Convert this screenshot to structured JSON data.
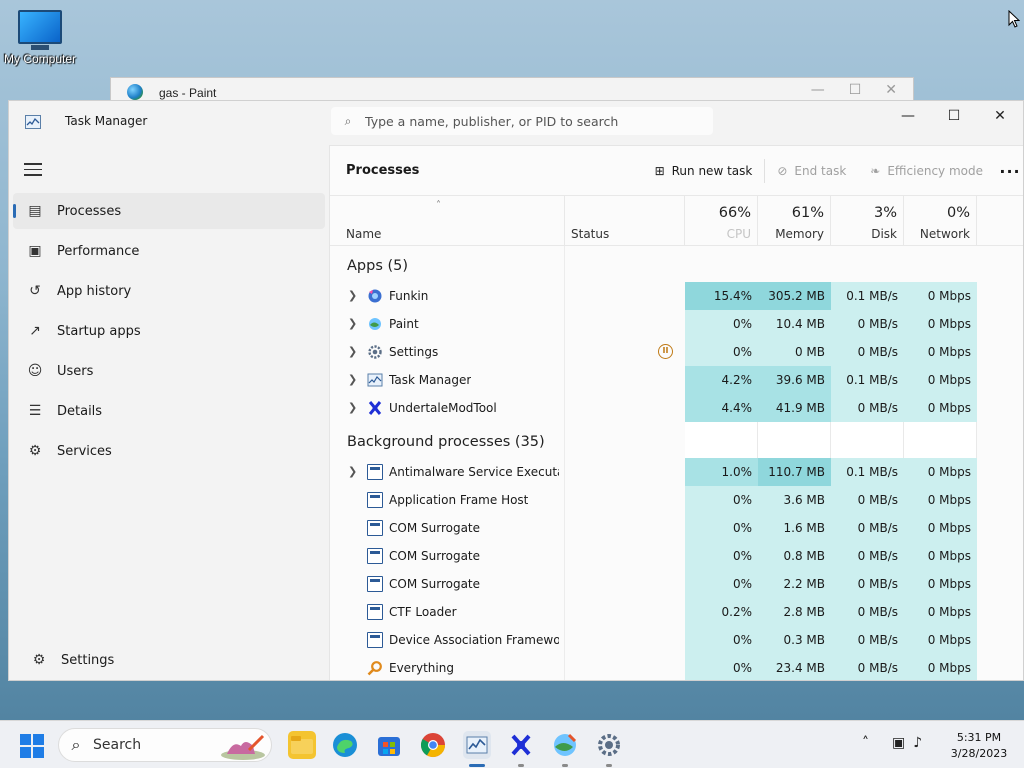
{
  "desktop": {
    "icon_label": "My Computer"
  },
  "paint": {
    "title": "gas - Paint"
  },
  "task_manager": {
    "title": "Task Manager",
    "search_placeholder": "Type a name, publisher, or PID to search",
    "nav": [
      {
        "label": "Processes",
        "icon": "processes-icon"
      },
      {
        "label": "Performance",
        "icon": "performance-icon"
      },
      {
        "label": "App history",
        "icon": "app-history-icon"
      },
      {
        "label": "Startup apps",
        "icon": "startup-apps-icon"
      },
      {
        "label": "Users",
        "icon": "users-icon"
      },
      {
        "label": "Details",
        "icon": "details-icon"
      },
      {
        "label": "Services",
        "icon": "services-icon"
      }
    ],
    "settings_label": "Settings",
    "page_title": "Processes",
    "toolbar": {
      "run_new_task": "Run new task",
      "end_task": "End task",
      "efficiency_mode": "Efficiency mode"
    },
    "columns": {
      "name": "Name",
      "status": "Status",
      "cpu": {
        "pct": "66%",
        "label": "CPU"
      },
      "memory": {
        "pct": "61%",
        "label": "Memory"
      },
      "disk": {
        "pct": "3%",
        "label": "Disk"
      },
      "network": {
        "pct": "0%",
        "label": "Network"
      }
    },
    "apps_group": "Apps (5)",
    "apps": [
      {
        "name": "Funkin",
        "cpu": "15.4%",
        "memory": "305.2 MB",
        "disk": "0.1 MB/s",
        "network": "0 Mbps",
        "status": ""
      },
      {
        "name": "Paint",
        "cpu": "0%",
        "memory": "10.4 MB",
        "disk": "0 MB/s",
        "network": "0 Mbps",
        "status": ""
      },
      {
        "name": "Settings",
        "cpu": "0%",
        "memory": "0 MB",
        "disk": "0 MB/s",
        "network": "0 Mbps",
        "status": "suspended"
      },
      {
        "name": "Task Manager",
        "cpu": "4.2%",
        "memory": "39.6 MB",
        "disk": "0.1 MB/s",
        "network": "0 Mbps",
        "status": ""
      },
      {
        "name": "UndertaleModTool",
        "cpu": "4.4%",
        "memory": "41.9 MB",
        "disk": "0 MB/s",
        "network": "0 Mbps",
        "status": ""
      }
    ],
    "background_group": "Background processes (35)",
    "background": [
      {
        "name": "Antimalware Service Executable",
        "cpu": "1.0%",
        "memory": "110.7 MB",
        "disk": "0.1 MB/s",
        "network": "0 Mbps",
        "expandable": true
      },
      {
        "name": "Application Frame Host",
        "cpu": "0%",
        "memory": "3.6 MB",
        "disk": "0 MB/s",
        "network": "0 Mbps"
      },
      {
        "name": "COM Surrogate",
        "cpu": "0%",
        "memory": "1.6 MB",
        "disk": "0 MB/s",
        "network": "0 Mbps"
      },
      {
        "name": "COM Surrogate",
        "cpu": "0%",
        "memory": "0.8 MB",
        "disk": "0 MB/s",
        "network": "0 Mbps"
      },
      {
        "name": "COM Surrogate",
        "cpu": "0%",
        "memory": "2.2 MB",
        "disk": "0 MB/s",
        "network": "0 Mbps"
      },
      {
        "name": "CTF Loader",
        "cpu": "0.2%",
        "memory": "2.8 MB",
        "disk": "0 MB/s",
        "network": "0 Mbps"
      },
      {
        "name": "Device Association Framewor...",
        "cpu": "0%",
        "memory": "0.3 MB",
        "disk": "0 MB/s",
        "network": "0 Mbps"
      },
      {
        "name": "Everything",
        "cpu": "0%",
        "memory": "23.4 MB",
        "disk": "0 MB/s",
        "network": "0 Mbps"
      }
    ]
  },
  "taskbar": {
    "search_label": "Search",
    "time": "5:31 PM",
    "date": "3/28/2023"
  },
  "colors": {
    "accent": "#2b6cb5",
    "heat_low": "#ccefef",
    "heat_mid": "#a8e2e5",
    "heat_high": "#8fd7dc"
  }
}
